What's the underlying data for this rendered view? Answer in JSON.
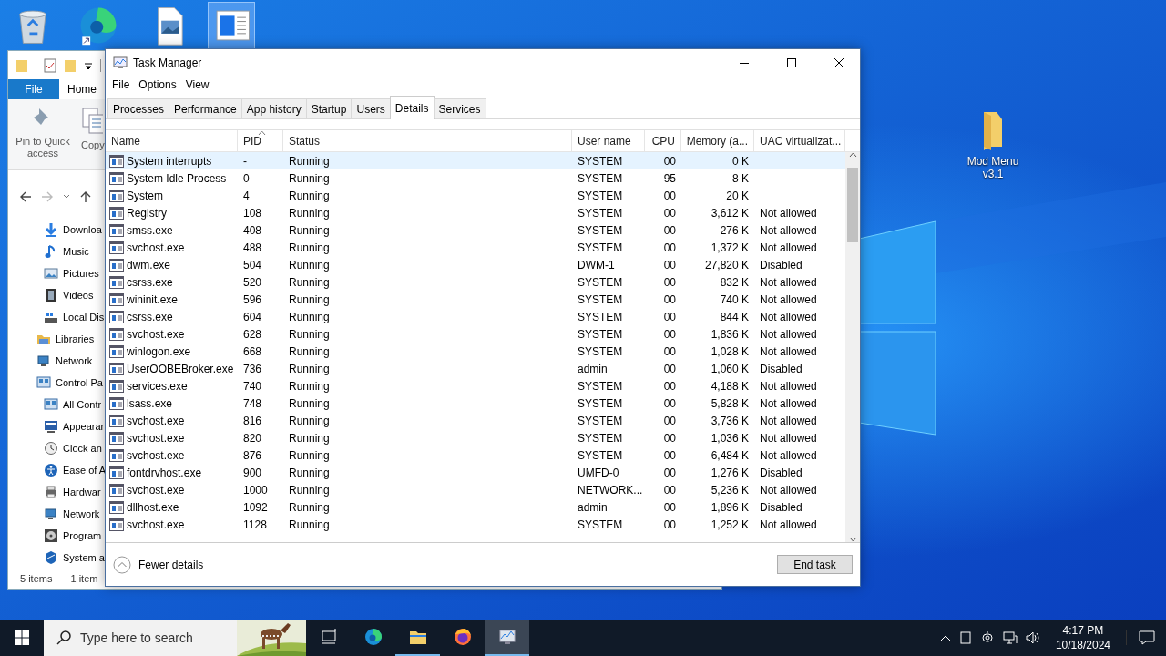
{
  "desktop_icons": [
    {
      "selected": false
    },
    {
      "selected": false
    },
    {
      "selected": false
    },
    {
      "selected": true
    },
    {
      "label": "Mod Menu v3.1",
      "selected": false
    }
  ],
  "explorer": {
    "ribbon_tabs": [
      {
        "label": "File",
        "kind": "file"
      },
      {
        "label": "Home",
        "kind": "tab"
      }
    ],
    "ribbon_buttons": [
      "Pin to Quick access",
      "Copy"
    ],
    "nav_tree": {
      "quick_access_children": [
        {
          "label": "Downloa"
        },
        {
          "label": "Music"
        },
        {
          "label": "Pictures"
        },
        {
          "label": "Videos"
        },
        {
          "label": "Local Dis"
        }
      ],
      "roots": [
        {
          "label": "Libraries"
        },
        {
          "label": "Network"
        },
        {
          "label": "Control Pa",
          "children": [
            {
              "label": "All Contr"
            },
            {
              "label": "Appearar"
            },
            {
              "label": "Clock an"
            },
            {
              "label": "Ease of A"
            },
            {
              "label": "Hardwar"
            },
            {
              "label": "Network"
            },
            {
              "label": "Program"
            },
            {
              "label": "System a"
            }
          ]
        }
      ]
    },
    "status_bar": [
      "5 items",
      "1 item"
    ]
  },
  "task_manager": {
    "title": "Task Manager",
    "menu": [
      "File",
      "Options",
      "View"
    ],
    "tabs": [
      {
        "label": "Processes",
        "selected": false
      },
      {
        "label": "Performance",
        "selected": false
      },
      {
        "label": "App history",
        "selected": false
      },
      {
        "label": "Startup",
        "selected": false
      },
      {
        "label": "Users",
        "selected": false
      },
      {
        "label": "Details",
        "selected": true
      },
      {
        "label": "Services",
        "selected": false
      }
    ],
    "columns": [
      {
        "label": "Name",
        "sorted": false
      },
      {
        "label": "PID",
        "sorted": true
      },
      {
        "label": "Status",
        "sorted": false
      },
      {
        "label": "User name",
        "sorted": false
      },
      {
        "label": "CPU",
        "sorted": false
      },
      {
        "label": "Memory (a...",
        "sorted": false
      },
      {
        "label": "UAC virtualizat...",
        "sorted": false
      }
    ],
    "rows": [
      {
        "selected": true,
        "cells": [
          "System interrupts",
          "-",
          "Running",
          "SYSTEM",
          "00",
          "0 K",
          ""
        ]
      },
      {
        "selected": false,
        "cells": [
          "System Idle Process",
          "0",
          "Running",
          "SYSTEM",
          "95",
          "8 K",
          ""
        ]
      },
      {
        "selected": false,
        "cells": [
          "System",
          "4",
          "Running",
          "SYSTEM",
          "00",
          "20 K",
          ""
        ]
      },
      {
        "selected": false,
        "cells": [
          "Registry",
          "108",
          "Running",
          "SYSTEM",
          "00",
          "3,612 K",
          "Not allowed"
        ]
      },
      {
        "selected": false,
        "cells": [
          "smss.exe",
          "408",
          "Running",
          "SYSTEM",
          "00",
          "276 K",
          "Not allowed"
        ]
      },
      {
        "selected": false,
        "cells": [
          "svchost.exe",
          "488",
          "Running",
          "SYSTEM",
          "00",
          "1,372 K",
          "Not allowed"
        ]
      },
      {
        "selected": false,
        "cells": [
          "dwm.exe",
          "504",
          "Running",
          "DWM-1",
          "00",
          "27,820 K",
          "Disabled"
        ]
      },
      {
        "selected": false,
        "cells": [
          "csrss.exe",
          "520",
          "Running",
          "SYSTEM",
          "00",
          "832 K",
          "Not allowed"
        ]
      },
      {
        "selected": false,
        "cells": [
          "wininit.exe",
          "596",
          "Running",
          "SYSTEM",
          "00",
          "740 K",
          "Not allowed"
        ]
      },
      {
        "selected": false,
        "cells": [
          "csrss.exe",
          "604",
          "Running",
          "SYSTEM",
          "00",
          "844 K",
          "Not allowed"
        ]
      },
      {
        "selected": false,
        "cells": [
          "svchost.exe",
          "628",
          "Running",
          "SYSTEM",
          "00",
          "1,836 K",
          "Not allowed"
        ]
      },
      {
        "selected": false,
        "cells": [
          "winlogon.exe",
          "668",
          "Running",
          "SYSTEM",
          "00",
          "1,028 K",
          "Not allowed"
        ]
      },
      {
        "selected": false,
        "cells": [
          "UserOOBEBroker.exe",
          "736",
          "Running",
          "admin",
          "00",
          "1,060 K",
          "Disabled"
        ]
      },
      {
        "selected": false,
        "cells": [
          "services.exe",
          "740",
          "Running",
          "SYSTEM",
          "00",
          "4,188 K",
          "Not allowed"
        ]
      },
      {
        "selected": false,
        "cells": [
          "lsass.exe",
          "748",
          "Running",
          "SYSTEM",
          "00",
          "5,828 K",
          "Not allowed"
        ]
      },
      {
        "selected": false,
        "cells": [
          "svchost.exe",
          "816",
          "Running",
          "SYSTEM",
          "00",
          "3,736 K",
          "Not allowed"
        ]
      },
      {
        "selected": false,
        "cells": [
          "svchost.exe",
          "820",
          "Running",
          "SYSTEM",
          "00",
          "1,036 K",
          "Not allowed"
        ]
      },
      {
        "selected": false,
        "cells": [
          "svchost.exe",
          "876",
          "Running",
          "SYSTEM",
          "00",
          "6,484 K",
          "Not allowed"
        ]
      },
      {
        "selected": false,
        "cells": [
          "fontdrvhost.exe",
          "900",
          "Running",
          "UMFD-0",
          "00",
          "1,276 K",
          "Disabled"
        ]
      },
      {
        "selected": false,
        "cells": [
          "svchost.exe",
          "1000",
          "Running",
          "NETWORK...",
          "00",
          "5,236 K",
          "Not allowed"
        ]
      },
      {
        "selected": false,
        "cells": [
          "dllhost.exe",
          "1092",
          "Running",
          "admin",
          "00",
          "1,896 K",
          "Disabled"
        ]
      },
      {
        "selected": false,
        "cells": [
          "svchost.exe",
          "1128",
          "Running",
          "SYSTEM",
          "00",
          "1,252 K",
          "Not allowed"
        ]
      }
    ],
    "fewer_details": "Fewer details",
    "end_task": "End task"
  },
  "taskbar": {
    "search_placeholder": "Type here to search",
    "apps": [
      {
        "running": false,
        "active": false
      },
      {
        "running": false,
        "active": false
      },
      {
        "running": true,
        "active": false
      },
      {
        "running": false,
        "active": false
      },
      {
        "running": true,
        "active": true
      }
    ],
    "time": "4:17 PM",
    "date": "10/18/2024"
  }
}
